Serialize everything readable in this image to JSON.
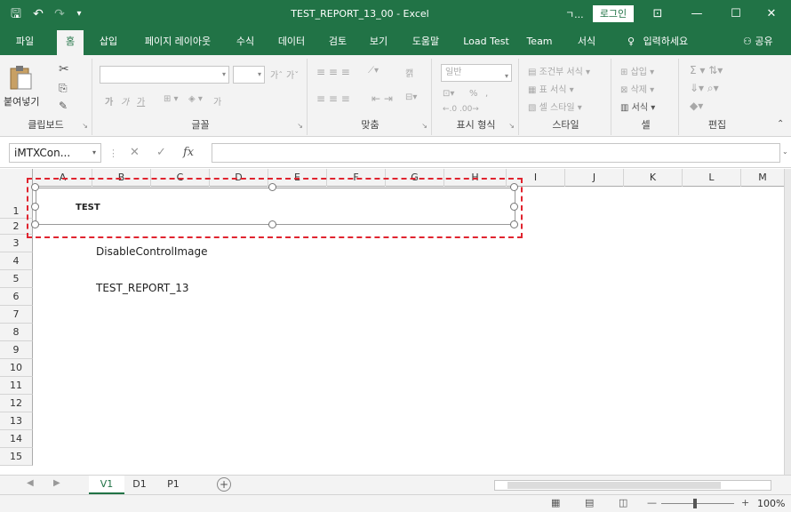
{
  "window": {
    "title": "TEST_REPORT_13_00  -  Excel",
    "title_abbrev": "ㄱ...",
    "login_label": "로그인",
    "quick_access": {
      "save": "🖫",
      "undo": "↶",
      "redo": "↷",
      "customize": "▾"
    },
    "controls": {
      "ribbon_display": "⊡",
      "minimize": "—",
      "restore": "☐",
      "close": "✕"
    }
  },
  "ribbon_tabs": [
    {
      "label": "파일"
    },
    {
      "label": "홈"
    },
    {
      "label": "삽입"
    },
    {
      "label": "페이지 레이아웃"
    },
    {
      "label": "수식"
    },
    {
      "label": "데이터"
    },
    {
      "label": "검토"
    },
    {
      "label": "보기"
    },
    {
      "label": "도움말"
    },
    {
      "label": "Load Test"
    },
    {
      "label": "Team"
    },
    {
      "label": "서식"
    }
  ],
  "tell_me": "입력하세요",
  "share": "공유",
  "ribbon": {
    "clipboard": {
      "label": "클립보드",
      "paste": "붙여넣기"
    },
    "font": {
      "label": "글꼴",
      "grow": "가ˆ",
      "shrink": "가ˇ",
      "bold": "가",
      "italic": "가",
      "underline": "가",
      "font_color": "가"
    },
    "alignment": {
      "label": "맞춤",
      "wrap": "캙"
    },
    "number": {
      "label": "표시 형식",
      "format_value": "일반",
      "percent": "%",
      "comma": ","
    },
    "styles": {
      "label": "스타일",
      "conditional": "조건부 서식",
      "table": "표 서식",
      "cell_styles": "셀 스타일"
    },
    "cells": {
      "label": "셀",
      "insert": "삽입",
      "delete": "삭제",
      "format": "서식"
    },
    "editing": {
      "label": "편집"
    }
  },
  "formula_bar": {
    "name_box": "iMTXCon...",
    "cancel": "✕",
    "enter": "✓",
    "fx": "fx",
    "value": ""
  },
  "columns": [
    "A",
    "B",
    "C",
    "D",
    "E",
    "F",
    "G",
    "H",
    "I",
    "J",
    "K",
    "L",
    "M"
  ],
  "rows": [
    "1",
    "2",
    "3",
    "4",
    "5",
    "6",
    "7",
    "8",
    "9",
    "10",
    "11",
    "12",
    "13",
    "14",
    "15"
  ],
  "cells": {
    "b3": "DisableControlImage",
    "b5": "TEST_REPORT_13"
  },
  "control": {
    "label": "TEST"
  },
  "sheets": [
    {
      "label": "V1"
    },
    {
      "label": "D1"
    },
    {
      "label": "P1"
    }
  ],
  "add_sheet": "+",
  "status": {
    "normal_view": "▦",
    "page_layout_view": "▤",
    "page_break_view": "◫",
    "zoom_out": "—",
    "zoom_in": "+",
    "zoom": "100%"
  }
}
